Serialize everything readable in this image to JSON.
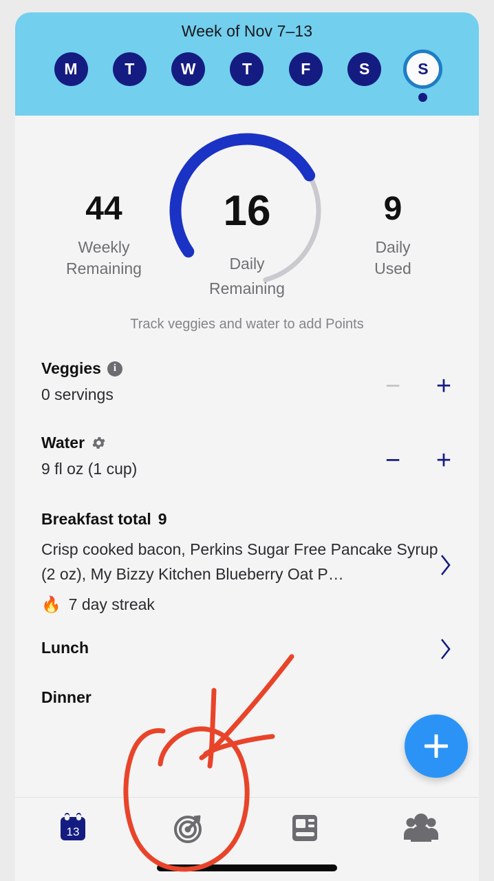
{
  "header": {
    "week_title": "Week of Nov 7–13",
    "days": [
      {
        "letter": "M",
        "name": "monday",
        "selected": false
      },
      {
        "letter": "T",
        "name": "tuesday",
        "selected": false
      },
      {
        "letter": "W",
        "name": "wednesday",
        "selected": false
      },
      {
        "letter": "T",
        "name": "thursday",
        "selected": false
      },
      {
        "letter": "F",
        "name": "friday",
        "selected": false
      },
      {
        "letter": "S",
        "name": "saturday",
        "selected": false
      },
      {
        "letter": "S",
        "name": "sunday",
        "selected": true
      }
    ],
    "bg_color": "#72cfed",
    "pill_color": "#151c81",
    "selected_ring_color": "#1f7dc6"
  },
  "summary": {
    "weekly_remaining_value": "44",
    "weekly_remaining_label": "Weekly\nRemaining",
    "weekly_remaining_label_line1": "Weekly",
    "weekly_remaining_label_line2": "Remaining",
    "daily_remaining_value": "16",
    "daily_remaining_label_line1": "Daily",
    "daily_remaining_label_line2": "Remaining",
    "daily_used_value": "9",
    "daily_used_label_line1": "Daily",
    "daily_used_label_line2": "Used",
    "hint": "Track veggies and water to add Points",
    "gauge": {
      "progress_color": "#1a33c4",
      "track_color": "#c9c9cf",
      "percent_filled": 64,
      "start_angle_deg": 215,
      "sweep_total_deg": 290
    }
  },
  "trackers": [
    {
      "name": "veggies",
      "title": "Veggies",
      "icon": "info-icon",
      "value": "0 servings",
      "minus_label": "−",
      "plus_label": "+",
      "minus_disabled": true
    },
    {
      "name": "water",
      "title": "Water",
      "icon": "gear-icon",
      "value": "9 fl oz (1 cup)",
      "minus_label": "−",
      "plus_label": "+",
      "minus_disabled": false
    }
  ],
  "meals": [
    {
      "name": "breakfast",
      "title": "Breakfast total",
      "points": "9",
      "items": "Crisp cooked bacon, Perkins Sugar Free Pancake Syrup (2 oz), My Bizzy Kitchen Blueberry Oat P…",
      "streak": "7 day streak",
      "streak_icon": "🔥"
    },
    {
      "name": "lunch",
      "title": "Lunch",
      "points": "",
      "items": "",
      "streak": ""
    },
    {
      "name": "dinner",
      "title": "Dinner",
      "points": "",
      "items": "",
      "streak": ""
    }
  ],
  "fab": {
    "label": "+",
    "color": "#2b93f5"
  },
  "bottom_nav": [
    {
      "name": "calendar",
      "icon": "calendar-icon",
      "badge": "13",
      "active": true
    },
    {
      "name": "plan",
      "icon": "target-icon",
      "badge": "",
      "active": false
    },
    {
      "name": "articles",
      "icon": "article-icon",
      "badge": "",
      "active": false
    },
    {
      "name": "community",
      "icon": "community-icon",
      "badge": "",
      "active": false
    }
  ],
  "annotation": {
    "color": "#e8442a",
    "description": "hand-drawn circle and arrow highlighting the target tab"
  }
}
